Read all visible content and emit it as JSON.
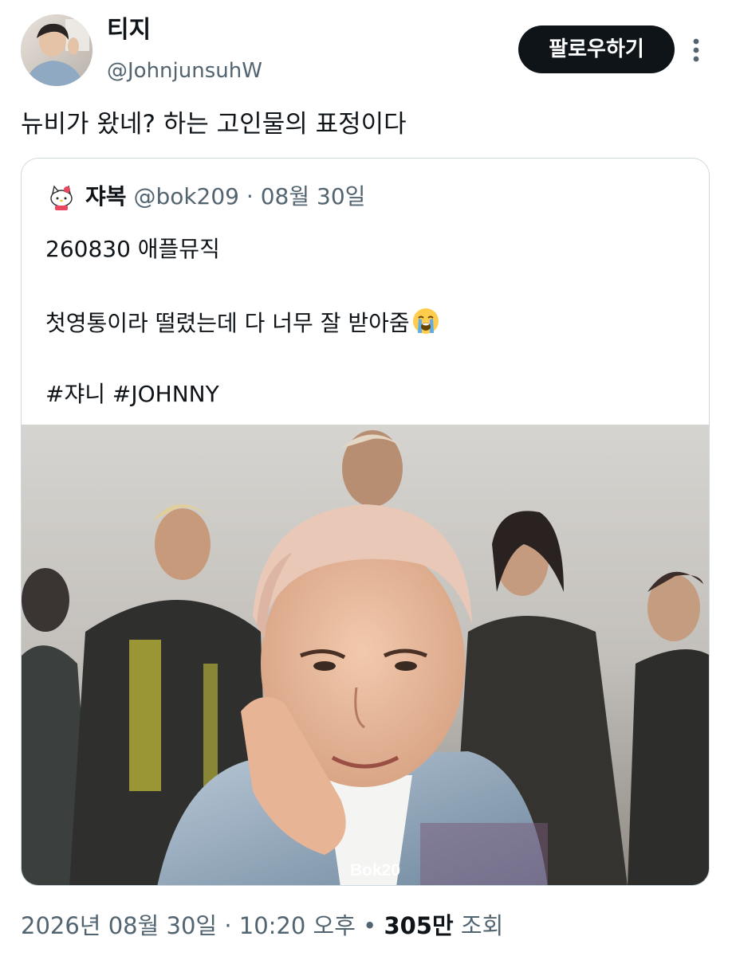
{
  "author": {
    "display_name": "티지",
    "handle": "@JohnjunsuhW",
    "avatar_icon": "profile-photo"
  },
  "actions": {
    "follow_label": "팔로우하기",
    "more_icon": "more-vertical-icon"
  },
  "tweet": {
    "text": "뉴비가 왔네? 하는 고인물의 표정이다"
  },
  "quote": {
    "avatar_icon": "hello-kitty-icon",
    "name": "쟈복",
    "handle": "@bok209",
    "separator": "·",
    "date": "08월 30일",
    "lines": [
      "260830 애플뮤직",
      "첫영통이라 떨렸는데 다 너무 잘 받아줌",
      "#쟈니 #JOHNNY"
    ],
    "emoji_icon": "loudly-crying-face-icon",
    "media": {
      "watermark": "Bok20"
    }
  },
  "footer": {
    "date": "2026년 08월 30일",
    "separator_1": "·",
    "time": "10:20 오후",
    "separator_2": "•",
    "views_count": "305만",
    "views_label": "조회"
  },
  "colors": {
    "text_primary": "#0f1419",
    "text_secondary": "#536471",
    "border": "#cfd9de",
    "button_bg": "#0f1419"
  }
}
